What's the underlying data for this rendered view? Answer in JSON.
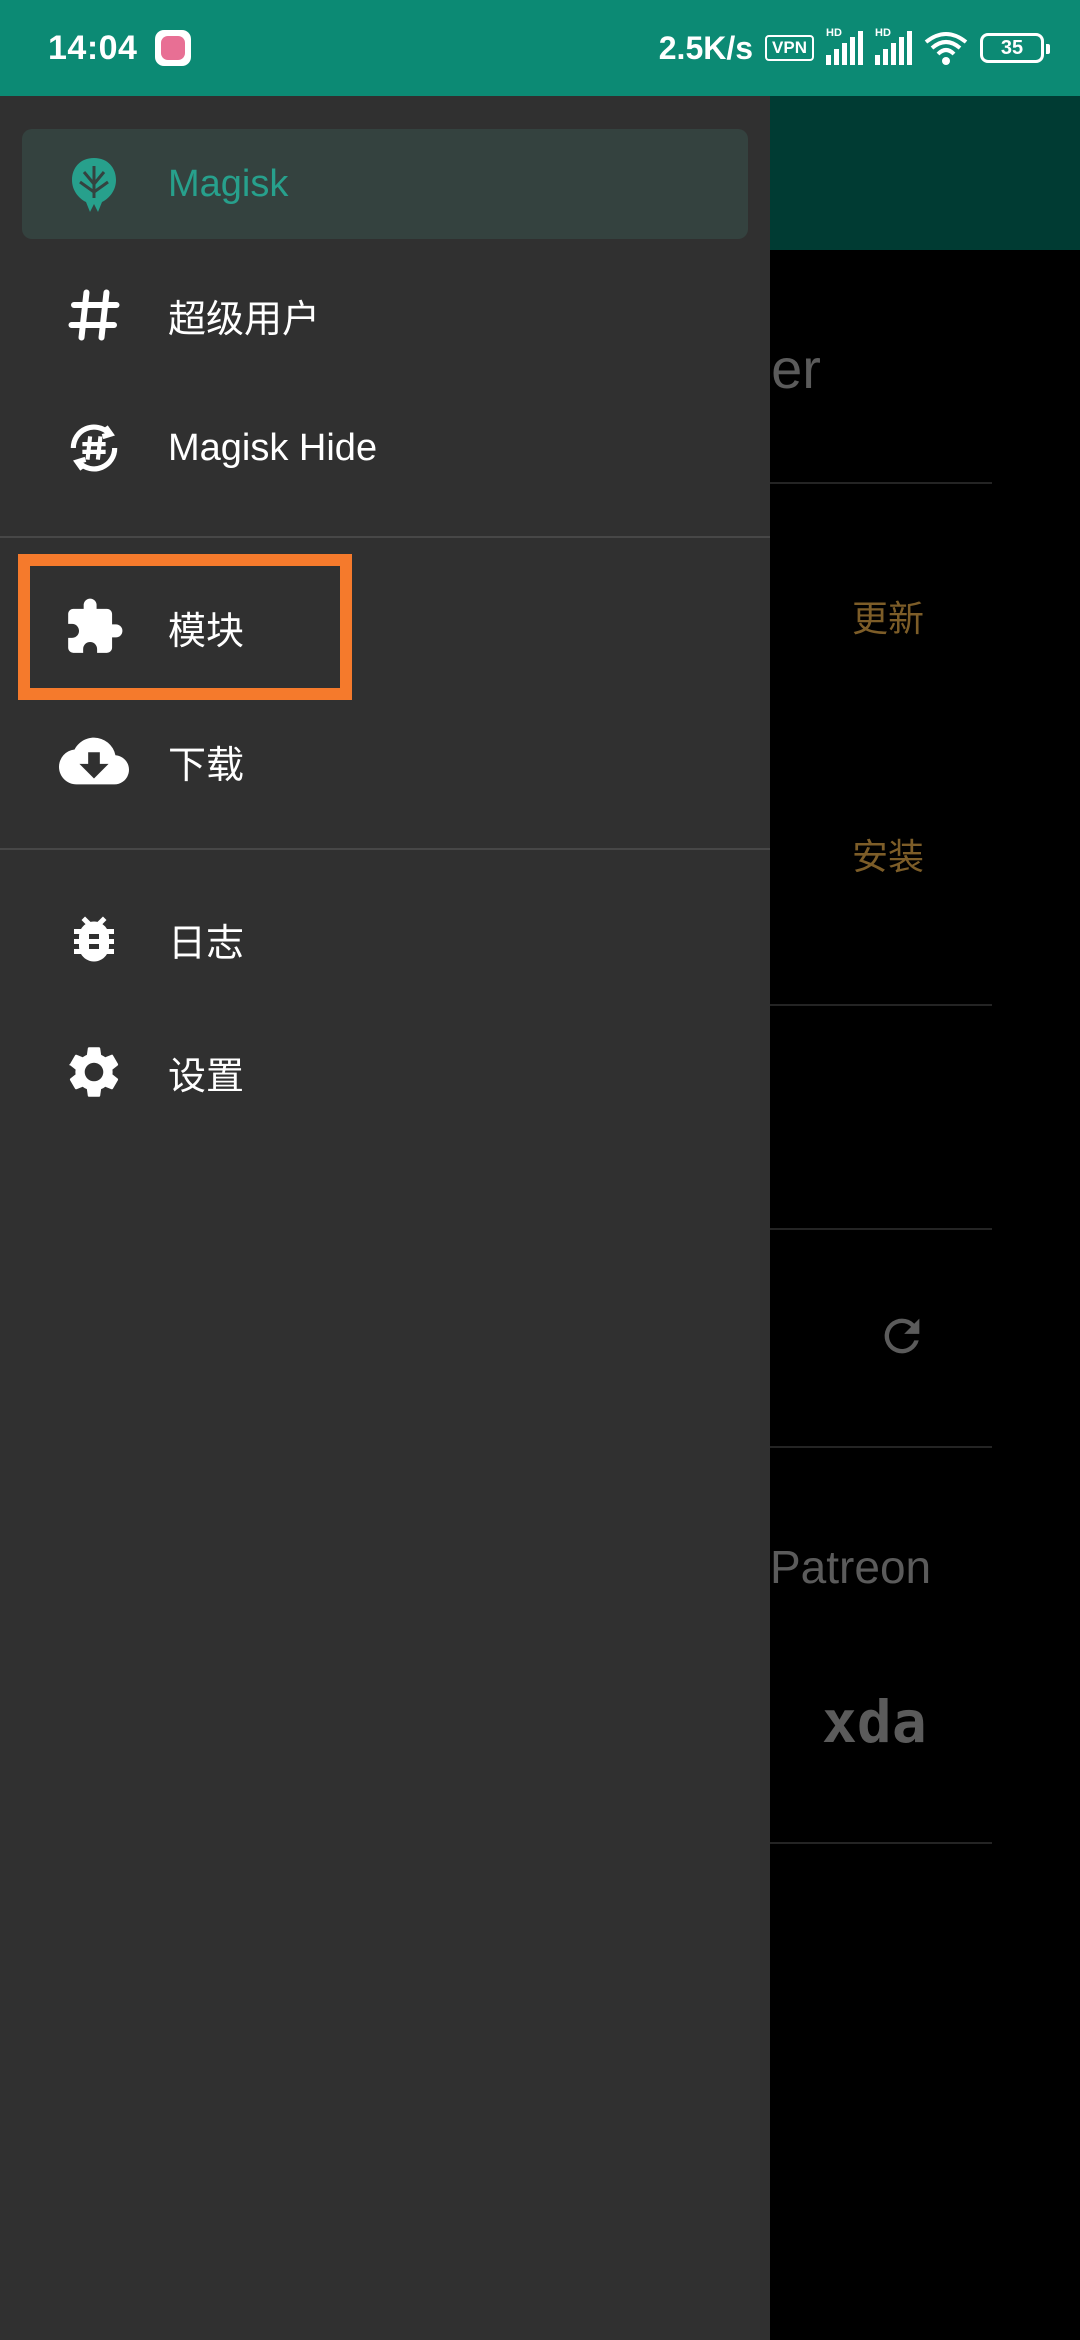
{
  "status_bar": {
    "time": "14:04",
    "network_speed": "2.5K/s",
    "vpn": "VPN",
    "sim1": "HD",
    "sim2": "HD",
    "battery": "35"
  },
  "drawer": {
    "header_label": "Magisk",
    "items": [
      {
        "label": "超级用户",
        "icon": "hash-icon"
      },
      {
        "label": "Magisk Hide",
        "icon": "magisk-hide-icon"
      },
      {
        "label": "模块",
        "icon": "puzzle-icon"
      },
      {
        "label": "下载",
        "icon": "cloud-download-icon"
      },
      {
        "label": "日志",
        "icon": "bug-icon"
      },
      {
        "label": "设置",
        "icon": "gear-icon"
      }
    ]
  },
  "background": {
    "title_fragment": "ger",
    "update_action": "更新",
    "install_action": "安装",
    "patreon_label": "Patreon",
    "xda_label": "xda"
  },
  "colors": {
    "status_bar": "#0c8a74",
    "drawer_bg": "#303030",
    "accent": "#27a08c",
    "highlight": "#f57a2c"
  }
}
